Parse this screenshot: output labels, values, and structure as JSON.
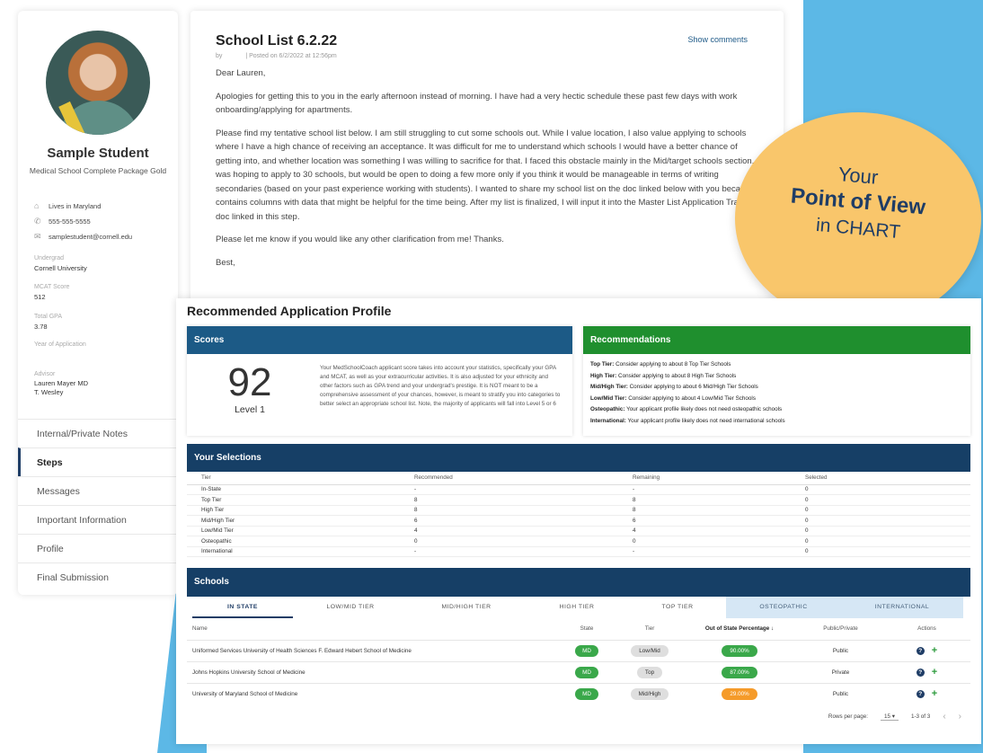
{
  "profile": {
    "name": "Sample Student",
    "package": "Medical School Complete Package Gold",
    "location": "Lives in Maryland",
    "phone": "555-555-5555",
    "email": "samplestudent@cornell.edu",
    "undergrad_label": "Undergrad",
    "undergrad": "Cornell University",
    "mcat_label": "MCAT Score",
    "mcat": "512",
    "gpa_label": "Total GPA",
    "gpa": "3.78",
    "year_label": "Year of Application",
    "advisor_label": "Advisor",
    "advisor_1": "Lauren Mayer MD",
    "advisor_2": "T. Wesley"
  },
  "nav": [
    {
      "label": "Internal/Private Notes"
    },
    {
      "label": "Steps"
    },
    {
      "label": "Messages"
    },
    {
      "label": "Important Information"
    },
    {
      "label": "Profile"
    },
    {
      "label": "Final Submission"
    }
  ],
  "letter": {
    "title": "School List 6.2.22",
    "by": "by",
    "posted": "| Posted on 6/2/2022 at 12:56pm",
    "show_comments": "Show comments",
    "greeting": "Dear Lauren,",
    "p1": "Apologies for getting this to you in the early afternoon instead of morning. I have had a very hectic schedule these past few days with work onboarding/applying for apartments.",
    "p2": "Please find my tentative school list below. I am still struggling to cut some schools out. While I value location, I also value applying to schools where I have a high chance of receiving an acceptance. It was difficult for me to understand which schools I would have a better chance of getting into, and whether location was something I was willing to sacrifice for that. I faced this obstacle mainly in the Mid/target schools section.  I was hoping to apply to 30 schools, but would be open to doing a few more only if you think it would be manageable in terms of writing secondaries (based on your past experience working with students). I wanted to share my school list on the doc linked below with you because it contains columns with data that might be helpful for the time being. After my list is finalized, I will input it into the Master List Application Tracker doc linked in this step.",
    "p3": "Please let me know if you would like any other clarification from me! Thanks.",
    "closing": "Best,"
  },
  "badge": {
    "line1": "Your",
    "line2": "Point of View",
    "line3": "in CHART",
    "color": "#f9c66b"
  },
  "rap": {
    "title": "Recommended Application Profile",
    "scores_head": "Scores",
    "score": "92",
    "level": "Level 1",
    "score_desc": "Your MedSchoolCoach applicant score takes into account your statistics, specifically your GPA and MCAT, as well as your extracurricular activities. It is also adjusted for your ethnicity and other factors such as GPA trend and your undergrad's prestige. It is NOT meant to be a comprehensive assessment of your chances, however, is meant to stratify you into categories to better select an appropriate school list. Note, the majority of applicants will fall into Level 5 or 6",
    "rec_head": "Recommendations",
    "recs": [
      {
        "k": "Top Tier:",
        "v": "Consider applying to about 8 Top Tier Schools"
      },
      {
        "k": "High Tier:",
        "v": "Consider applying to about 8 High Tier Schools"
      },
      {
        "k": "Mid/High Tier:",
        "v": "Consider applying to about 6 Mid/High Tier Schools"
      },
      {
        "k": "Low/Mid Tier:",
        "v": "Consider applying to about 4 Low/Mid Tier Schools"
      },
      {
        "k": "Osteopathic:",
        "v": "Your applicant profile likely does not need osteopathic schools"
      },
      {
        "k": "International:",
        "v": "Your applicant profile likely does not need international schools"
      }
    ],
    "sel_head": "Your Selections",
    "sel_cols": [
      "Tier",
      "Recommended",
      "Remaining",
      "Selected"
    ],
    "sel_rows": [
      [
        "In-State",
        "-",
        "-",
        "0"
      ],
      [
        "Top Tier",
        "8",
        "8",
        "0"
      ],
      [
        "High Tier",
        "8",
        "8",
        "0"
      ],
      [
        "Mid/High Tier",
        "6",
        "6",
        "0"
      ],
      [
        "Low/Mid Tier",
        "4",
        "4",
        "0"
      ],
      [
        "Osteopathic",
        "0",
        "0",
        "0"
      ],
      [
        "International",
        "-",
        "-",
        "0"
      ]
    ],
    "sch_head": "Schools",
    "tabs": [
      "IN STATE",
      "LOW/MID TIER",
      "MID/HIGH TIER",
      "HIGH TIER",
      "TOP TIER",
      "OSTEOPATHIC",
      "INTERNATIONAL"
    ],
    "sch_cols": [
      "Name",
      "State",
      "Tier",
      "Out of State Percentage ↓",
      "Public/Private",
      "Actions"
    ],
    "schools": [
      {
        "name": "Uniformed Services University of Health Sciences F. Edward Hebert School of Medicine",
        "state": "MD",
        "tier": "Low/Mid",
        "pct": "90.00%",
        "pct_color": "green",
        "type": "Public"
      },
      {
        "name": "Johns Hopkins University School of Medicine",
        "state": "MD",
        "tier": "Top",
        "pct": "87.00%",
        "pct_color": "green",
        "type": "Private"
      },
      {
        "name": "University of Maryland School of Medicine",
        "state": "MD",
        "tier": "Mid/High",
        "pct": "29.00%",
        "pct_color": "orange",
        "type": "Public"
      }
    ],
    "rows_per_page_label": "Rows per page:",
    "rows_per_page": "15",
    "range": "1-3 of 3"
  }
}
